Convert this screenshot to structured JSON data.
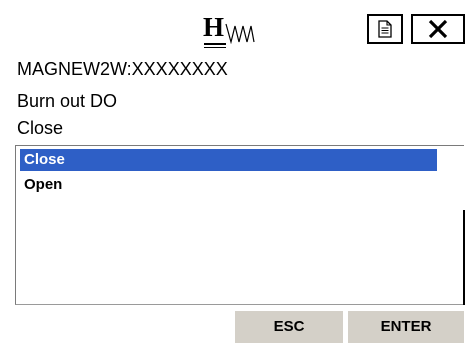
{
  "header": {
    "logo_letter": "H",
    "logo_icon": "wave-logo-icon",
    "doc_button_icon": "document-icon",
    "close_button_icon": "close-icon"
  },
  "device": {
    "tag": "MAGNEW2W:XXXXXXXX",
    "parameter": "Burn out DO",
    "current_value": "Close"
  },
  "options": {
    "items": [
      "Close",
      "Open"
    ],
    "selected": "Close"
  },
  "buttons": {
    "esc_label": "ESC",
    "enter_label": "ENTER"
  },
  "colors": {
    "selection": "#2e5fc6",
    "button_face": "#d4d0c8"
  }
}
